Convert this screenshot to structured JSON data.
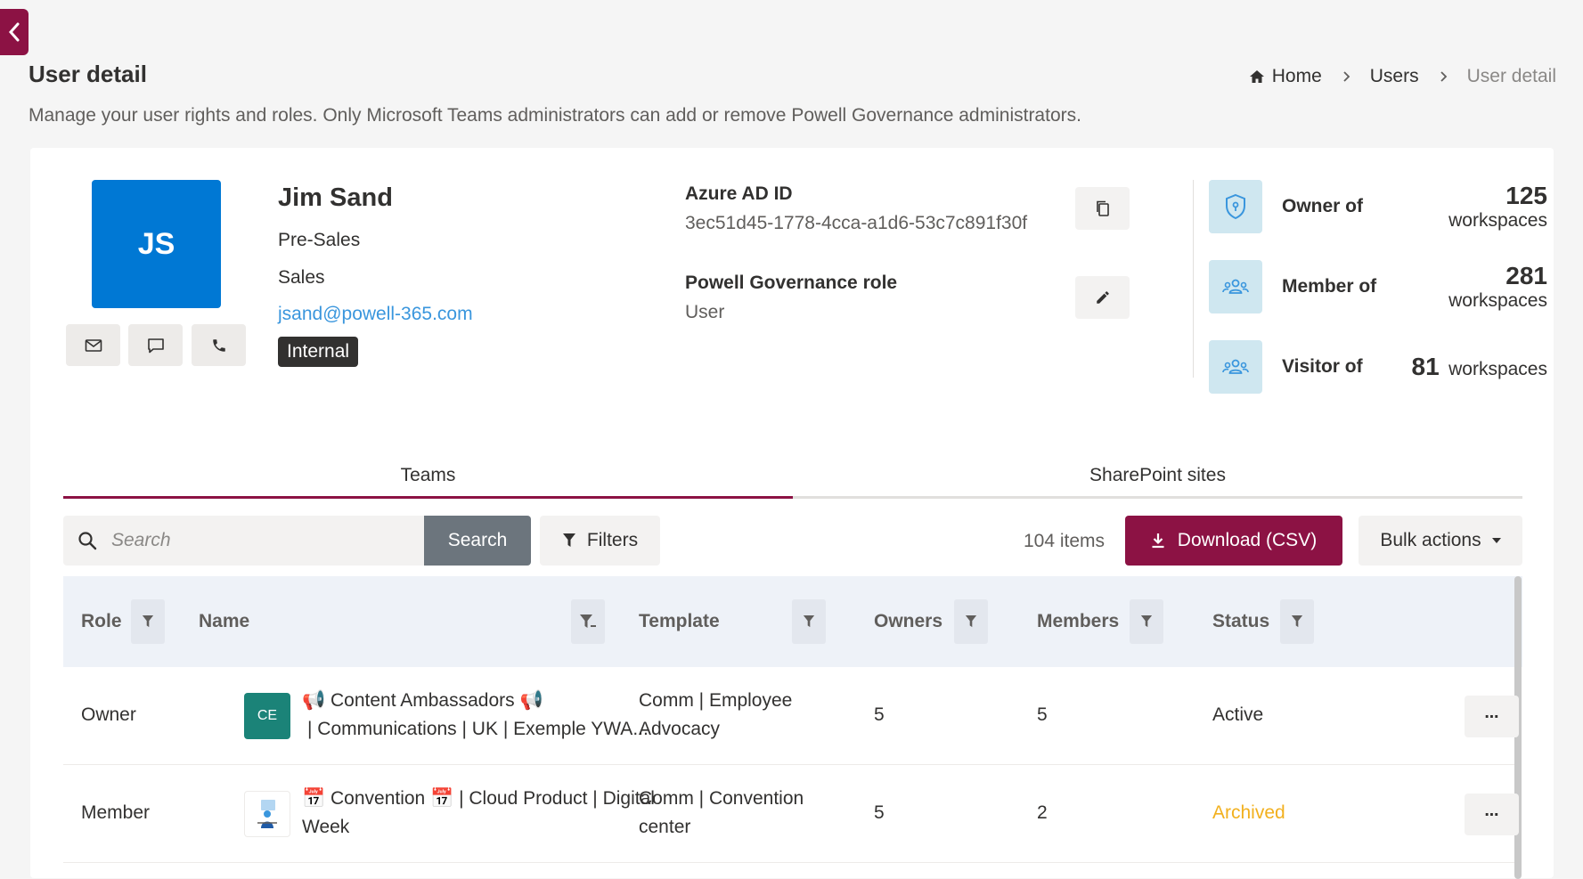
{
  "page": {
    "title": "User detail",
    "description": "Manage your user rights and roles. Only Microsoft Teams administrators can add or remove Powell Governance administrators."
  },
  "breadcrumb": {
    "home": "Home",
    "users": "Users",
    "current": "User detail"
  },
  "user": {
    "initials": "JS",
    "name": "Jim Sand",
    "job_title": "Pre-Sales",
    "department": "Sales",
    "email": "jsand@powell-365.com",
    "type_tag": "Internal",
    "avatar_color": "#0078d4"
  },
  "info": {
    "azure_label": "Azure AD ID",
    "azure_value": "3ec51d45-1778-4cca-a1d6-53c7c891f30f",
    "role_label": "Powell Governance role",
    "role_value": "User"
  },
  "stats": [
    {
      "label": "Owner of",
      "count": "125",
      "unit": "workspaces",
      "icon": "shield-icon"
    },
    {
      "label": "Member of",
      "count": "281",
      "unit": "workspaces",
      "icon": "people-icon"
    },
    {
      "label": "Visitor of",
      "count": "81",
      "unit": "workspaces",
      "icon": "people-icon"
    }
  ],
  "tabs": [
    {
      "label": "Teams",
      "active": true
    },
    {
      "label": "SharePoint sites",
      "active": false
    }
  ],
  "toolbar": {
    "search_placeholder": "Search",
    "search_button": "Search",
    "filters_button": "Filters",
    "items_count": "104 items",
    "download_button": "Download (CSV)",
    "bulk_button": "Bulk actions"
  },
  "table": {
    "columns": [
      "Role",
      "Name",
      "Template",
      "Owners",
      "Members",
      "Status"
    ],
    "rows": [
      {
        "role": "Owner",
        "avatar_text": "CE",
        "avatar_color": "#1b8378",
        "name_line1": "Content Ambassadors",
        "name_line2": "| Communications | UK | Exemple YWA...",
        "template_line1": "Comm | Employee",
        "template_line2": "Advocacy",
        "owners": "5",
        "members": "5",
        "status": "Active",
        "status_color": "#323130"
      },
      {
        "role": "Member",
        "avatar_text": "",
        "avatar_color": "#ffffff",
        "name_line1": "Convention",
        "name_line1b": "| Cloud Product | Digital",
        "name_line2": "Week",
        "template_line1": "Comm | Convention",
        "template_line2": "center",
        "owners": "5",
        "members": "2",
        "status": "Archived",
        "status_color": "#f2b01e"
      }
    ]
  },
  "colors": {
    "accent": "#8c1244",
    "link": "#3a96dd",
    "stat_icon_bg": "#cfe7f0"
  }
}
